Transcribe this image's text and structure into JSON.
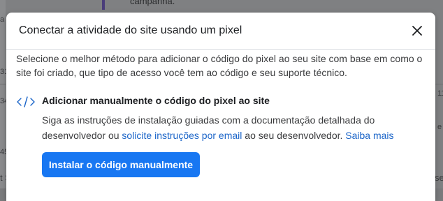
{
  "background": {
    "top_text": "campanha.",
    "side_texts": [
      "a T",
      "31",
      "34",
      "45",
      "t S",
      "11",
      "e",
      "se"
    ]
  },
  "modal": {
    "title": "Conectar a atividade do site usando um pixel",
    "close_icon": "close-icon",
    "description": "Selecione o melhor método para adicionar o código do pixel ao seu site com base em como o site foi criado, que tipo de acesso você tem ao código e seu suporte técnico.",
    "option": {
      "icon": "code-icon",
      "title": "Adicionar manualmente o código do pixel ao site",
      "desc_before": "Siga as instruções de instalação guiadas com a documentação detalhada do desenvolvedor ou ",
      "desc_link": "solicite instruções por email",
      "desc_middle": " ao seu desenvolvedor. ",
      "desc_learn_more": "Saiba mais",
      "button_label": "Instalar o código manualmente"
    }
  },
  "colors": {
    "primary": "#1877f2",
    "link": "#1a64c8",
    "overlay": "#7f8082"
  }
}
